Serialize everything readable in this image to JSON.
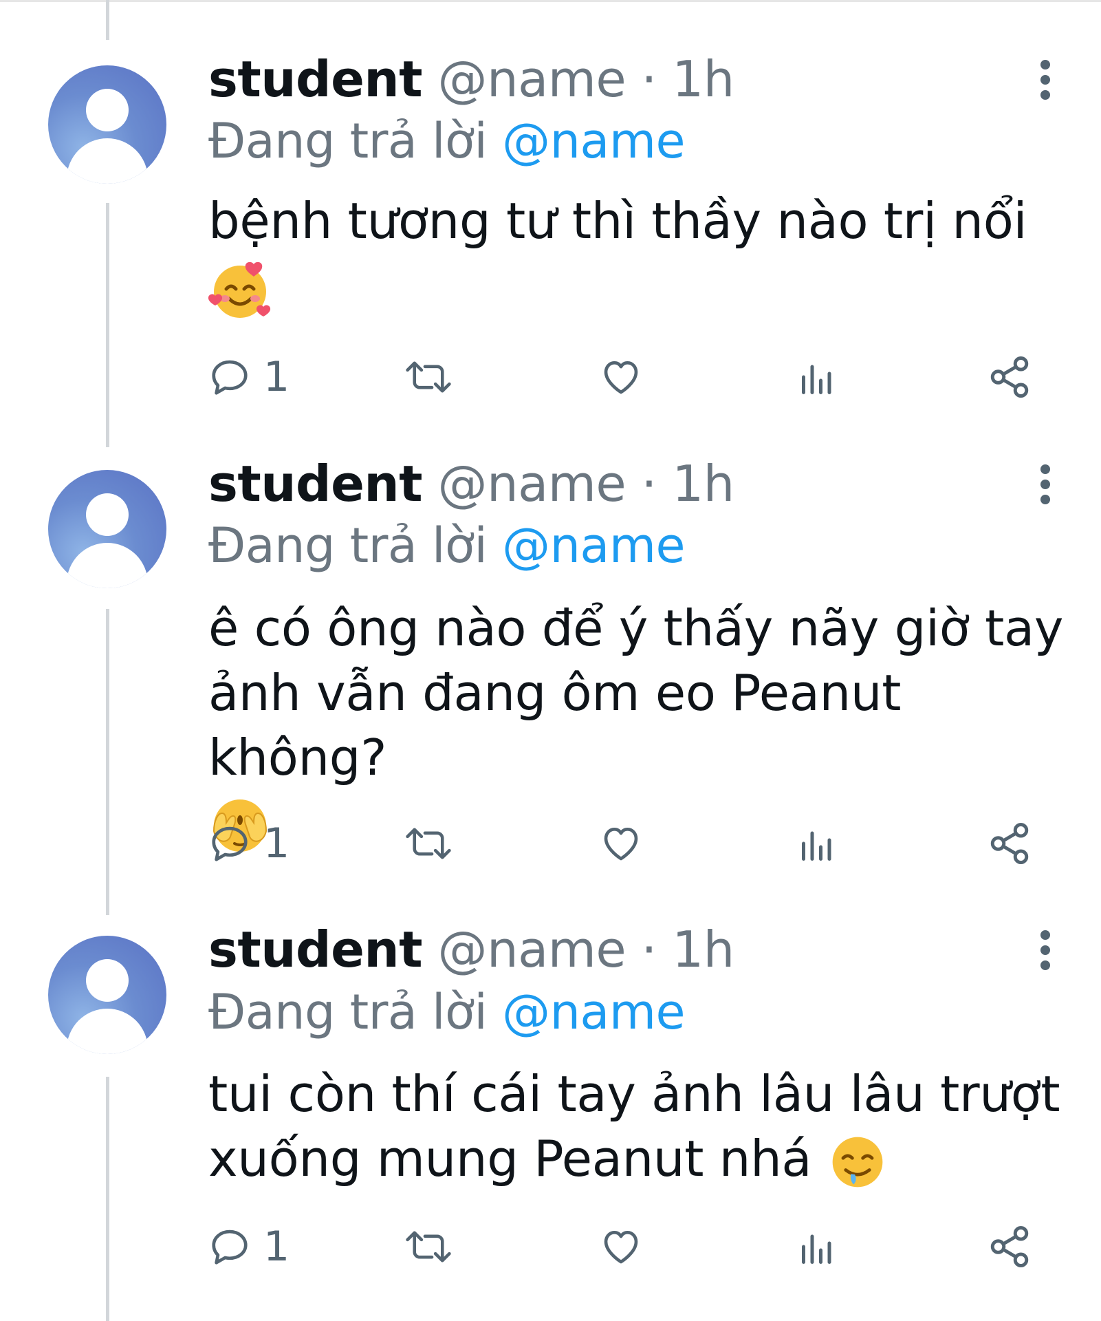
{
  "tweets": [
    {
      "username": "student",
      "handle": "@name",
      "dot": "·",
      "time": "1h",
      "replying_prefix": "Đang trả lời",
      "replying_to": "@name",
      "text": "bệnh tương tư thì thầy nào trị nổi",
      "emoji": "smiling-face-with-hearts",
      "reply_count": "1"
    },
    {
      "username": "student",
      "handle": "@name",
      "dot": "·",
      "time": "1h",
      "replying_prefix": "Đang trả lời",
      "replying_to": "@name",
      "text": "ê có ông nào để ý thấy nãy giờ tay ảnh vẫn đang ôm eo Peanut không?",
      "emoji": "face-with-hand-over-eyes",
      "reply_count": "1"
    },
    {
      "username": "student",
      "handle": "@name",
      "dot": "·",
      "time": "1h",
      "replying_prefix": "Đang trả lời",
      "replying_to": "@name",
      "text": "tui còn thí cái tay ảnh lâu lâu trượt xuống mung Peanut nhá",
      "emoji": "drooling-face",
      "reply_count": "1"
    }
  ],
  "colors": {
    "mention": "#1d9bf0",
    "secondary_text": "#6b7680",
    "icon": "#536471",
    "avatar": "#6b8cd0"
  }
}
